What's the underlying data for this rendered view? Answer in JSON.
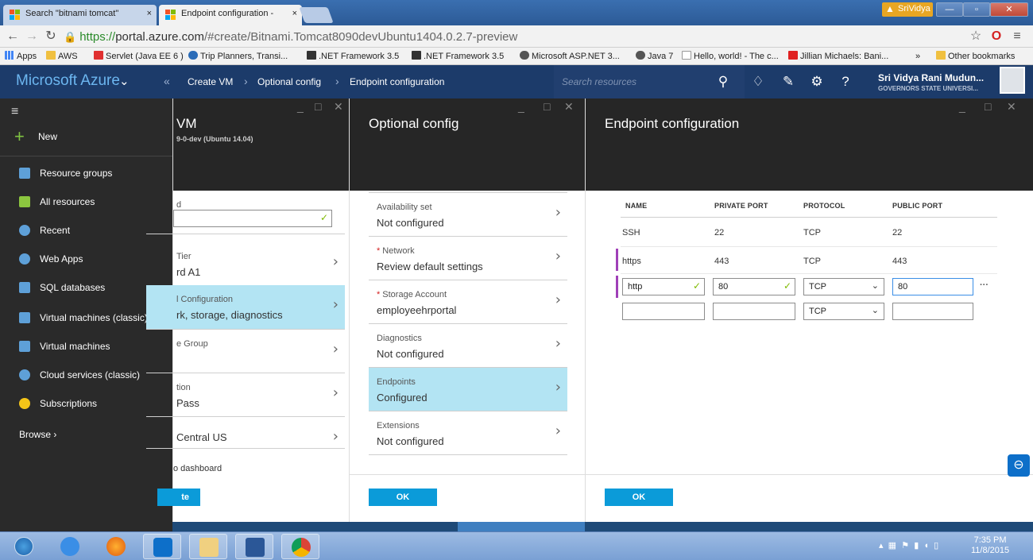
{
  "browser": {
    "tabs": [
      {
        "title": "Search \"bitnami tomcat\"",
        "close": "×",
        "favicon": "bing-icon"
      },
      {
        "title": "Endpoint configuration - ",
        "close": "×",
        "favicon": "azure-icon"
      }
    ],
    "user_chip": "SriVidya",
    "window_buttons": [
      "—",
      "▫",
      "✕"
    ],
    "url_scheme": "https://",
    "url_host": "portal.azure.com",
    "url_path": "/#create/Bitnami.Tomcat8090devUbuntu1404.0.2.7-preview",
    "bookmarks": [
      "Apps",
      "AWS",
      "Servlet (Java EE 6 )",
      "Trip Planners, Transi...",
      ".NET Framework 3.5",
      ".NET Framework 3.5",
      "Microsoft ASP.NET 3...",
      "Java 7",
      "Hello, world! - The c...",
      "Jillian Michaels: Bani..."
    ],
    "bookmarks_more": "»",
    "other_bookmarks": "Other bookmarks"
  },
  "azure": {
    "brand": "Microsoft Azure",
    "breadcrumbs": [
      "Create VM",
      "Optional config",
      "Endpoint configuration"
    ],
    "search_placeholder": "Search resources",
    "user_name": "Sri Vidya Rani Mudun...",
    "user_org": "GOVERNORS STATE UNIVERSI..."
  },
  "leftnav": {
    "new_label": "New",
    "items": [
      {
        "label": "Resource groups",
        "icon": "resource-group-icon",
        "color": "#5ea0d8"
      },
      {
        "label": "All resources",
        "icon": "grid-icon",
        "color": "#8cc63f"
      },
      {
        "label": "Recent",
        "icon": "clock-icon",
        "color": "#5ea0d8"
      },
      {
        "label": "Web Apps",
        "icon": "web-app-icon",
        "color": "#5ea0d8"
      },
      {
        "label": "SQL databases",
        "icon": "sql-icon",
        "color": "#5ea0d8"
      },
      {
        "label": "Virtual machines (classic)",
        "icon": "vm-icon",
        "color": "#5ea0d8"
      },
      {
        "label": "Virtual machines",
        "icon": "vm-icon",
        "color": "#5ea0d8"
      },
      {
        "label": "Cloud services (classic)",
        "icon": "cloud-icon",
        "color": "#5ea0d8"
      },
      {
        "label": "Subscriptions",
        "icon": "key-icon",
        "color": "#f5c518"
      }
    ],
    "browse_label": "Browse"
  },
  "blade_vm": {
    "title": "VM",
    "subtitle": "9-0-dev (Ubuntu 14.04)",
    "items": [
      {
        "l1": "d",
        "l2": ""
      },
      {
        "l1": "Tier",
        "l2": "rd A1"
      },
      {
        "l1": "l Configuration",
        "l2": "rk, storage, diagnostics"
      },
      {
        "l1": "e Group",
        "l2": ""
      },
      {
        "l1": "tion",
        "l2": "Pass"
      },
      {
        "l1": "",
        "l2": "Central US"
      }
    ],
    "dashboard": "o dashboard",
    "create_btn": "te"
  },
  "blade_optional": {
    "title": "Optional config",
    "items": [
      {
        "l1": "Availability set",
        "l2": "Not configured",
        "required": false
      },
      {
        "l1": "Network",
        "l2": "Review default settings",
        "required": true
      },
      {
        "l1": "Storage Account",
        "l2": "employeehrportal",
        "required": true
      },
      {
        "l1": "Diagnostics",
        "l2": "Not configured",
        "required": false
      },
      {
        "l1": "Endpoints",
        "l2": "Configured",
        "required": false
      },
      {
        "l1": "Extensions",
        "l2": "Not configured",
        "required": false
      }
    ],
    "required_mark": "*",
    "ok": "OK"
  },
  "blade_endpoint": {
    "title": "Endpoint configuration",
    "headers": [
      "NAME",
      "PRIVATE PORT",
      "PROTOCOL",
      "PUBLIC PORT"
    ],
    "rows": [
      {
        "name": "SSH",
        "private": "22",
        "protocol": "TCP",
        "public": "22"
      },
      {
        "name": "https",
        "private": "443",
        "protocol": "TCP",
        "public": "443"
      }
    ],
    "edit_row": {
      "name": "http",
      "private": "80",
      "protocol": "TCP",
      "public": "80"
    },
    "new_row": {
      "name": "",
      "private": "",
      "protocol": "TCP",
      "public": ""
    },
    "more": "···",
    "ok": "OK"
  },
  "taskbar": {
    "time": "7:35 PM",
    "date": "11/8/2015"
  },
  "colors": {
    "azure_bar": "#1c3b6a",
    "selected_item": "#b3e4f3",
    "ok_button": "#0b9bd9",
    "check": "#7fba00"
  }
}
